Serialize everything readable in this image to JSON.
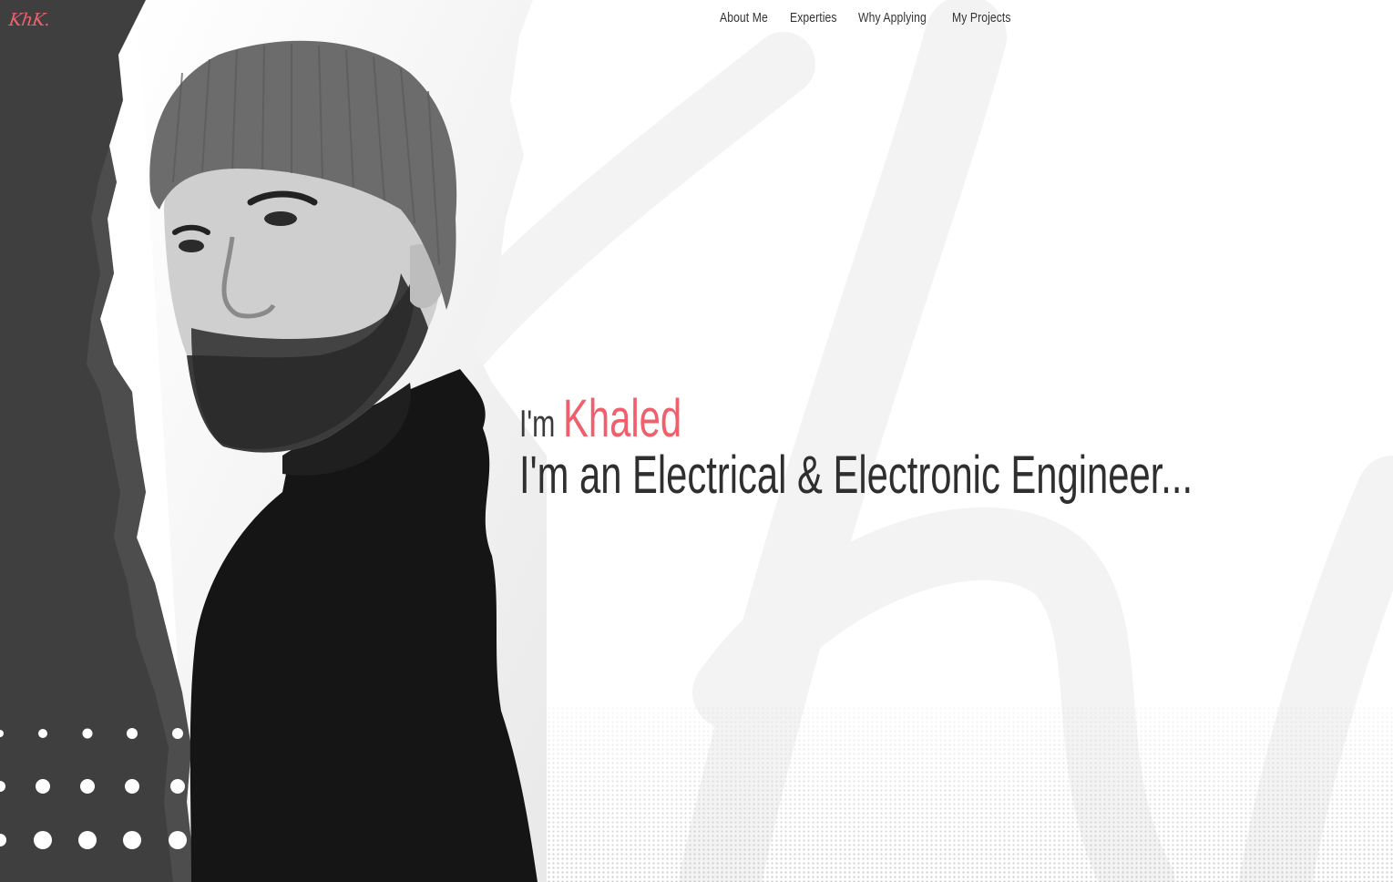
{
  "brand": {
    "logo_text": "KhK.",
    "accent_color": "#f0606c"
  },
  "nav": {
    "items": [
      {
        "label": "About Me"
      },
      {
        "label": "Experties"
      },
      {
        "label": "Why Applying"
      },
      {
        "label": "My Projects"
      }
    ]
  },
  "hero": {
    "greeting": "I'm",
    "name": "Khaled",
    "tagline": "I'm an Electrical & Electronic Engineer...",
    "text_color": "#2f2f2f"
  },
  "images": {
    "portrait": "portrait-photo-man-in-beanie",
    "background": "torn-paper-background"
  }
}
